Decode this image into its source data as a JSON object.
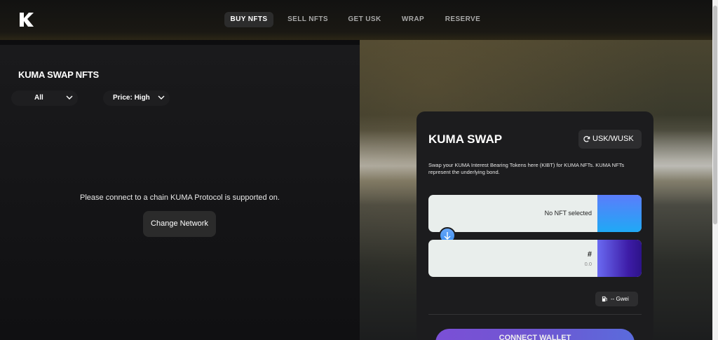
{
  "nav": {
    "items": [
      {
        "label": "BUY NFTS",
        "active": true
      },
      {
        "label": "SELL NFTS",
        "active": false
      },
      {
        "label": "GET USK",
        "active": false
      },
      {
        "label": "WRAP",
        "active": false
      },
      {
        "label": "RESERVE",
        "active": false
      }
    ]
  },
  "left": {
    "title": "KUMA SWAP NFTS",
    "filters": {
      "category": "All",
      "sort": "Price: High"
    },
    "message": "Please connect to a chain KUMA Protocol is supported on.",
    "change_network_label": "Change Network"
  },
  "swap": {
    "title": "KUMA SWAP",
    "token_button_label": "USK/WUSK",
    "description": "Swap your KUMA Interest Bearing Tokens here (KIBT) for KUMA NFTs. KUMA NFTs represent the underlying bond.",
    "nft_box_text": "No NFT selected",
    "amount_symbol": "#",
    "amount_value": "0.0",
    "gas_label": "-- Gwei",
    "connect_label": "CONNECT WALLET"
  },
  "colors": {
    "accent_blue": "#1fa9f5",
    "accent_purple": "#3d1ca7",
    "nav_active_bg": "#2c2c2c"
  }
}
